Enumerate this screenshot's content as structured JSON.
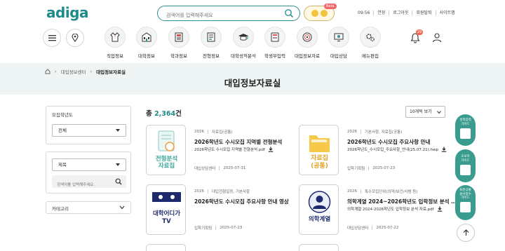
{
  "header": {
    "logo": "adiga",
    "search_placeholder": "검색어를 입력해주세요",
    "beta": "Beta",
    "time": "09:56",
    "links": [
      "연장",
      "로그아웃",
      "회원탈퇴",
      "사이트맵"
    ]
  },
  "nav": {
    "items": [
      {
        "label": "직업정보",
        "icon": "shirt-icon"
      },
      {
        "label": "대학정보",
        "icon": "building-icon"
      },
      {
        "label": "학과정보",
        "icon": "book-icon"
      },
      {
        "label": "전형정보",
        "icon": "document-icon"
      },
      {
        "label": "대학성적분석",
        "icon": "graduation-cap-icon"
      },
      {
        "label": "학생부입력",
        "icon": "notebook-icon"
      },
      {
        "label": "대입정보자료",
        "icon": "target-icon"
      },
      {
        "label": "대입상담",
        "icon": "monitor-icon"
      },
      {
        "label": "메뉴편집",
        "icon": "gear-icon"
      }
    ],
    "notification_count": "29"
  },
  "breadcrumb": {
    "parent": "대입정보센터",
    "current": "대입정보자료실"
  },
  "page_title": "대입정보자료실",
  "sidebar": {
    "year_label": "모집학년도",
    "year_value": "전체",
    "field_value": "제목",
    "keyword_placeholder": "검색어를 입력해주세요.",
    "category_label": "카테고리"
  },
  "list": {
    "total_prefix": "총",
    "total_count": "2,364",
    "total_suffix": "건",
    "sort": "10개씩 보기",
    "items": [
      {
        "year": "2026",
        "category": "자료집(공통)",
        "title": "2026학년도 수시모집 지역별 전형분석",
        "file": "2026학년도 수시모집 지역별 전형분석.pdf",
        "source": "대입상담센터",
        "date": "2025-07-31",
        "thumb_line1": "전형분석",
        "thumb_line2": "자료집"
      },
      {
        "year": "2026",
        "category": "기본사항, 자료집(공통)",
        "title": "2026학년도 수시모집 주요사항 안내",
        "file": "2026학년도_수시모집_주요사항_안내(25.07.21).hwp",
        "source": "입학기획팀",
        "date": "2025-07-23",
        "thumb_line1": "자료집",
        "thumb_line2": "(공통)"
      },
      {
        "year": "2026",
        "category": "대입전형일정, 기본사항",
        "title": "2026학년도 수시모집 주요사항 안내 영상",
        "file": "",
        "source": "입학기획팀",
        "date": "2025-07-23",
        "thumb_line1": "대학어디가",
        "thumb_line2": "TV"
      },
      {
        "year": "2026",
        "category": "특수모집단위(의약/보건/사범 등)",
        "title": "의학계열 2024~2026학년도 입학정보 분석 …",
        "file": "의학계열 2024-2026학년도 입학정보 분석 자료.pdf",
        "source": "대입상담센터",
        "date": "2025-07-22",
        "thumb_line1": "의학계열",
        "thumb_line2": ""
      }
    ]
  },
  "floating": [
    {
      "label1": "성적입력",
      "label2": "가이드"
    },
    {
      "label1": "초보자",
      "label2": "가이드"
    },
    {
      "label1": "표준공통",
      "label2": "원서접수",
      "label3": "가이드"
    }
  ],
  "colors": {
    "brand": "#1f8a8a",
    "banner": "#eef5f4",
    "fab": "#3a9c8f"
  }
}
